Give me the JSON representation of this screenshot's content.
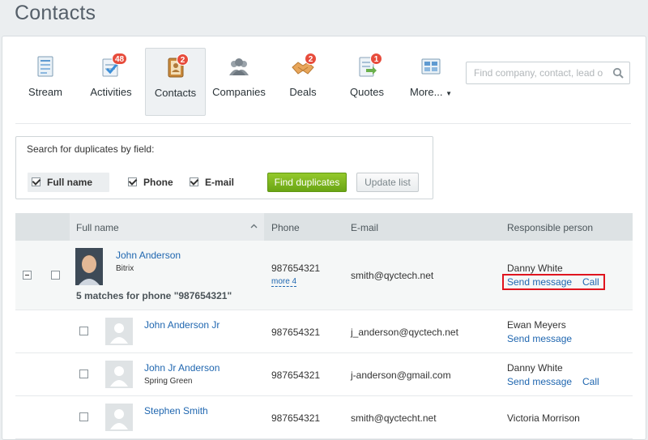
{
  "page_title": "Contacts",
  "toolbar": {
    "items": [
      {
        "label": "Stream",
        "icon": "stream-icon",
        "badge": ""
      },
      {
        "label": "Activities",
        "icon": "activities-icon",
        "badge": "48"
      },
      {
        "label": "Contacts",
        "icon": "contacts-icon",
        "badge": "2",
        "active": true
      },
      {
        "label": "Companies",
        "icon": "companies-icon",
        "badge": ""
      },
      {
        "label": "Deals",
        "icon": "deals-icon",
        "badge": "2"
      },
      {
        "label": "Quotes",
        "icon": "quotes-icon",
        "badge": "1"
      },
      {
        "label": "More...",
        "icon": "more-icon",
        "badge": ""
      }
    ],
    "search_placeholder": "Find company, contact, lead o"
  },
  "duplicates": {
    "title": "Search for duplicates by field:",
    "fields": [
      {
        "label": "Full name",
        "checked": true
      },
      {
        "label": "Phone",
        "checked": true
      },
      {
        "label": "E-mail",
        "checked": true
      }
    ],
    "find_button": "Find duplicates",
    "update_button": "Update list"
  },
  "grid": {
    "columns": [
      "Full name",
      "Phone",
      "E-mail",
      "Responsible person"
    ],
    "main": {
      "name": "John Anderson",
      "company": "Bitrix",
      "phone": "987654321",
      "more": "more 4",
      "email": "smith@qyctech.net",
      "responsible": "Danny White",
      "send_message": "Send message",
      "call": "Call",
      "matches": "5 matches for phone \"987654321\""
    },
    "rows": [
      {
        "name": "John Anderson Jr",
        "company": "",
        "phone": "987654321",
        "email": "j_anderson@qyctech.net",
        "responsible": "Ewan Meyers",
        "send_message": "Send message",
        "call": ""
      },
      {
        "name": "John Jr Anderson",
        "company": "Spring Green",
        "phone": "987654321",
        "email": "j-anderson@gmail.com",
        "responsible": "Danny White",
        "send_message": "Send message",
        "call": "Call"
      },
      {
        "name": "Stephen Smith",
        "company": "",
        "phone": "987654321",
        "email": "smith@qyctecht.net",
        "responsible": "Victoria Morrison",
        "send_message": "",
        "call": ""
      }
    ]
  },
  "colors": {
    "accent_link": "#2067b0",
    "badge": "#e74c3c",
    "find_button": "#7fb71f",
    "highlight": "#e0141e"
  }
}
